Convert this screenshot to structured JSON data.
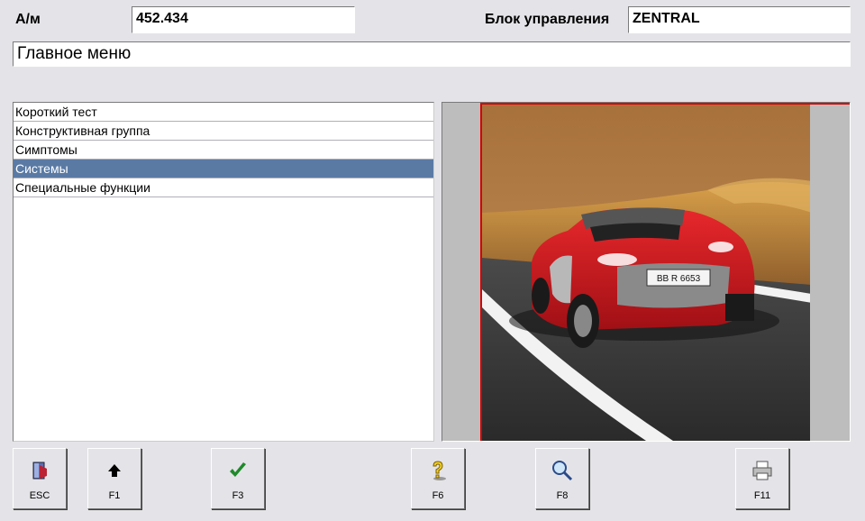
{
  "header": {
    "vehicle_label": "А/м",
    "vehicle_value": "452.434",
    "ecu_label": "Блок управления",
    "ecu_value": "ZENTRAL"
  },
  "title": "Главное меню",
  "menu": {
    "items": [
      {
        "label": "Короткий тест",
        "selected": false
      },
      {
        "label": "Конструктивная группа",
        "selected": false
      },
      {
        "label": "Симптомы",
        "selected": false
      },
      {
        "label": "Системы",
        "selected": true
      },
      {
        "label": "Специальные функции",
        "selected": false
      }
    ]
  },
  "image": {
    "plate_text": "BB R 6653",
    "accent_color": "#d40000"
  },
  "toolbar": {
    "buttons": [
      {
        "key": "ESC",
        "icon": "exit-door-icon"
      },
      {
        "key": "F1",
        "icon": "arrow-up-icon"
      },
      {
        "key": "F3",
        "icon": "checkmark-icon"
      },
      {
        "key": "F6",
        "icon": "help-question-icon"
      },
      {
        "key": "F8",
        "icon": "magnifier-icon"
      },
      {
        "key": "F11",
        "icon": "printer-icon"
      }
    ]
  },
  "colors": {
    "background": "#e4e4e8",
    "selection": "#5a7aa4"
  }
}
